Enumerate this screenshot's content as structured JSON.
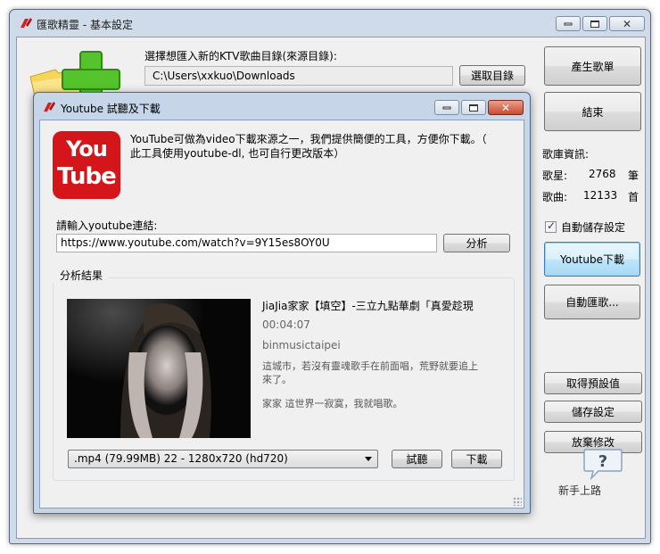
{
  "main_window": {
    "title": "匯歌精靈 - 基本設定",
    "source_label": "選擇想匯入新的KTV歌曲目錄(來源目錄):",
    "source_path": "C:\\Users\\xxkuo\\Downloads",
    "browse_button": "選取目錄",
    "generate_button": "產生歌單",
    "exit_button": "結束",
    "library_info": {
      "heading": "歌庫資訊:",
      "singers_label": "歌星:",
      "singers_value": "2768",
      "singers_unit": "筆",
      "songs_label": "歌曲:",
      "songs_value": "12133",
      "songs_unit": "首"
    },
    "autosave_label": "自動儲存設定",
    "autosave_checked": true,
    "youtube_button": "Youtube下載",
    "auto_import_button": "自動匯歌...",
    "get_defaults_button": "取得預設值",
    "save_settings_button": "儲存設定",
    "discard_button": "放棄修改",
    "help_label": "新手上路"
  },
  "dialog": {
    "title": "Youtube 試聽及下載",
    "logo_top": "You",
    "logo_bottom": "Tube",
    "intro_line1": "YouTube可做為video下載來源之一，我們提供簡便的工具，方便你下載。（",
    "intro_line2": "此工具使用youtube-dl, 也可自行更改版本）",
    "url_label": "請輸入youtube連結:",
    "url_value": "https://www.youtube.com/watch?v=9Y15es8OY0U",
    "analyze_button": "分析",
    "result_group_label": "分析結果",
    "video": {
      "title": "JiaJia家家【填空】-三立九點華劇「真愛趁現",
      "duration": "00:04:07",
      "channel": "binmusictaipei",
      "description_lines": [
        "這城市，若沒有靈魂歌手在前面唱，荒野就要追上",
        "來了。",
        "家家 這世界一寂寞，我就唱歌。"
      ]
    },
    "format_selected": ".mp4 (79.99MB) 22 - 1280x720 (hd720)",
    "preview_button": "試聽",
    "download_button": "下載"
  },
  "colors": {
    "window_frame": "#cfdbe8",
    "dialog_frame": "#c6d6e8",
    "youtube_red": "#d4151a",
    "focus_button": "#bee6fd"
  }
}
